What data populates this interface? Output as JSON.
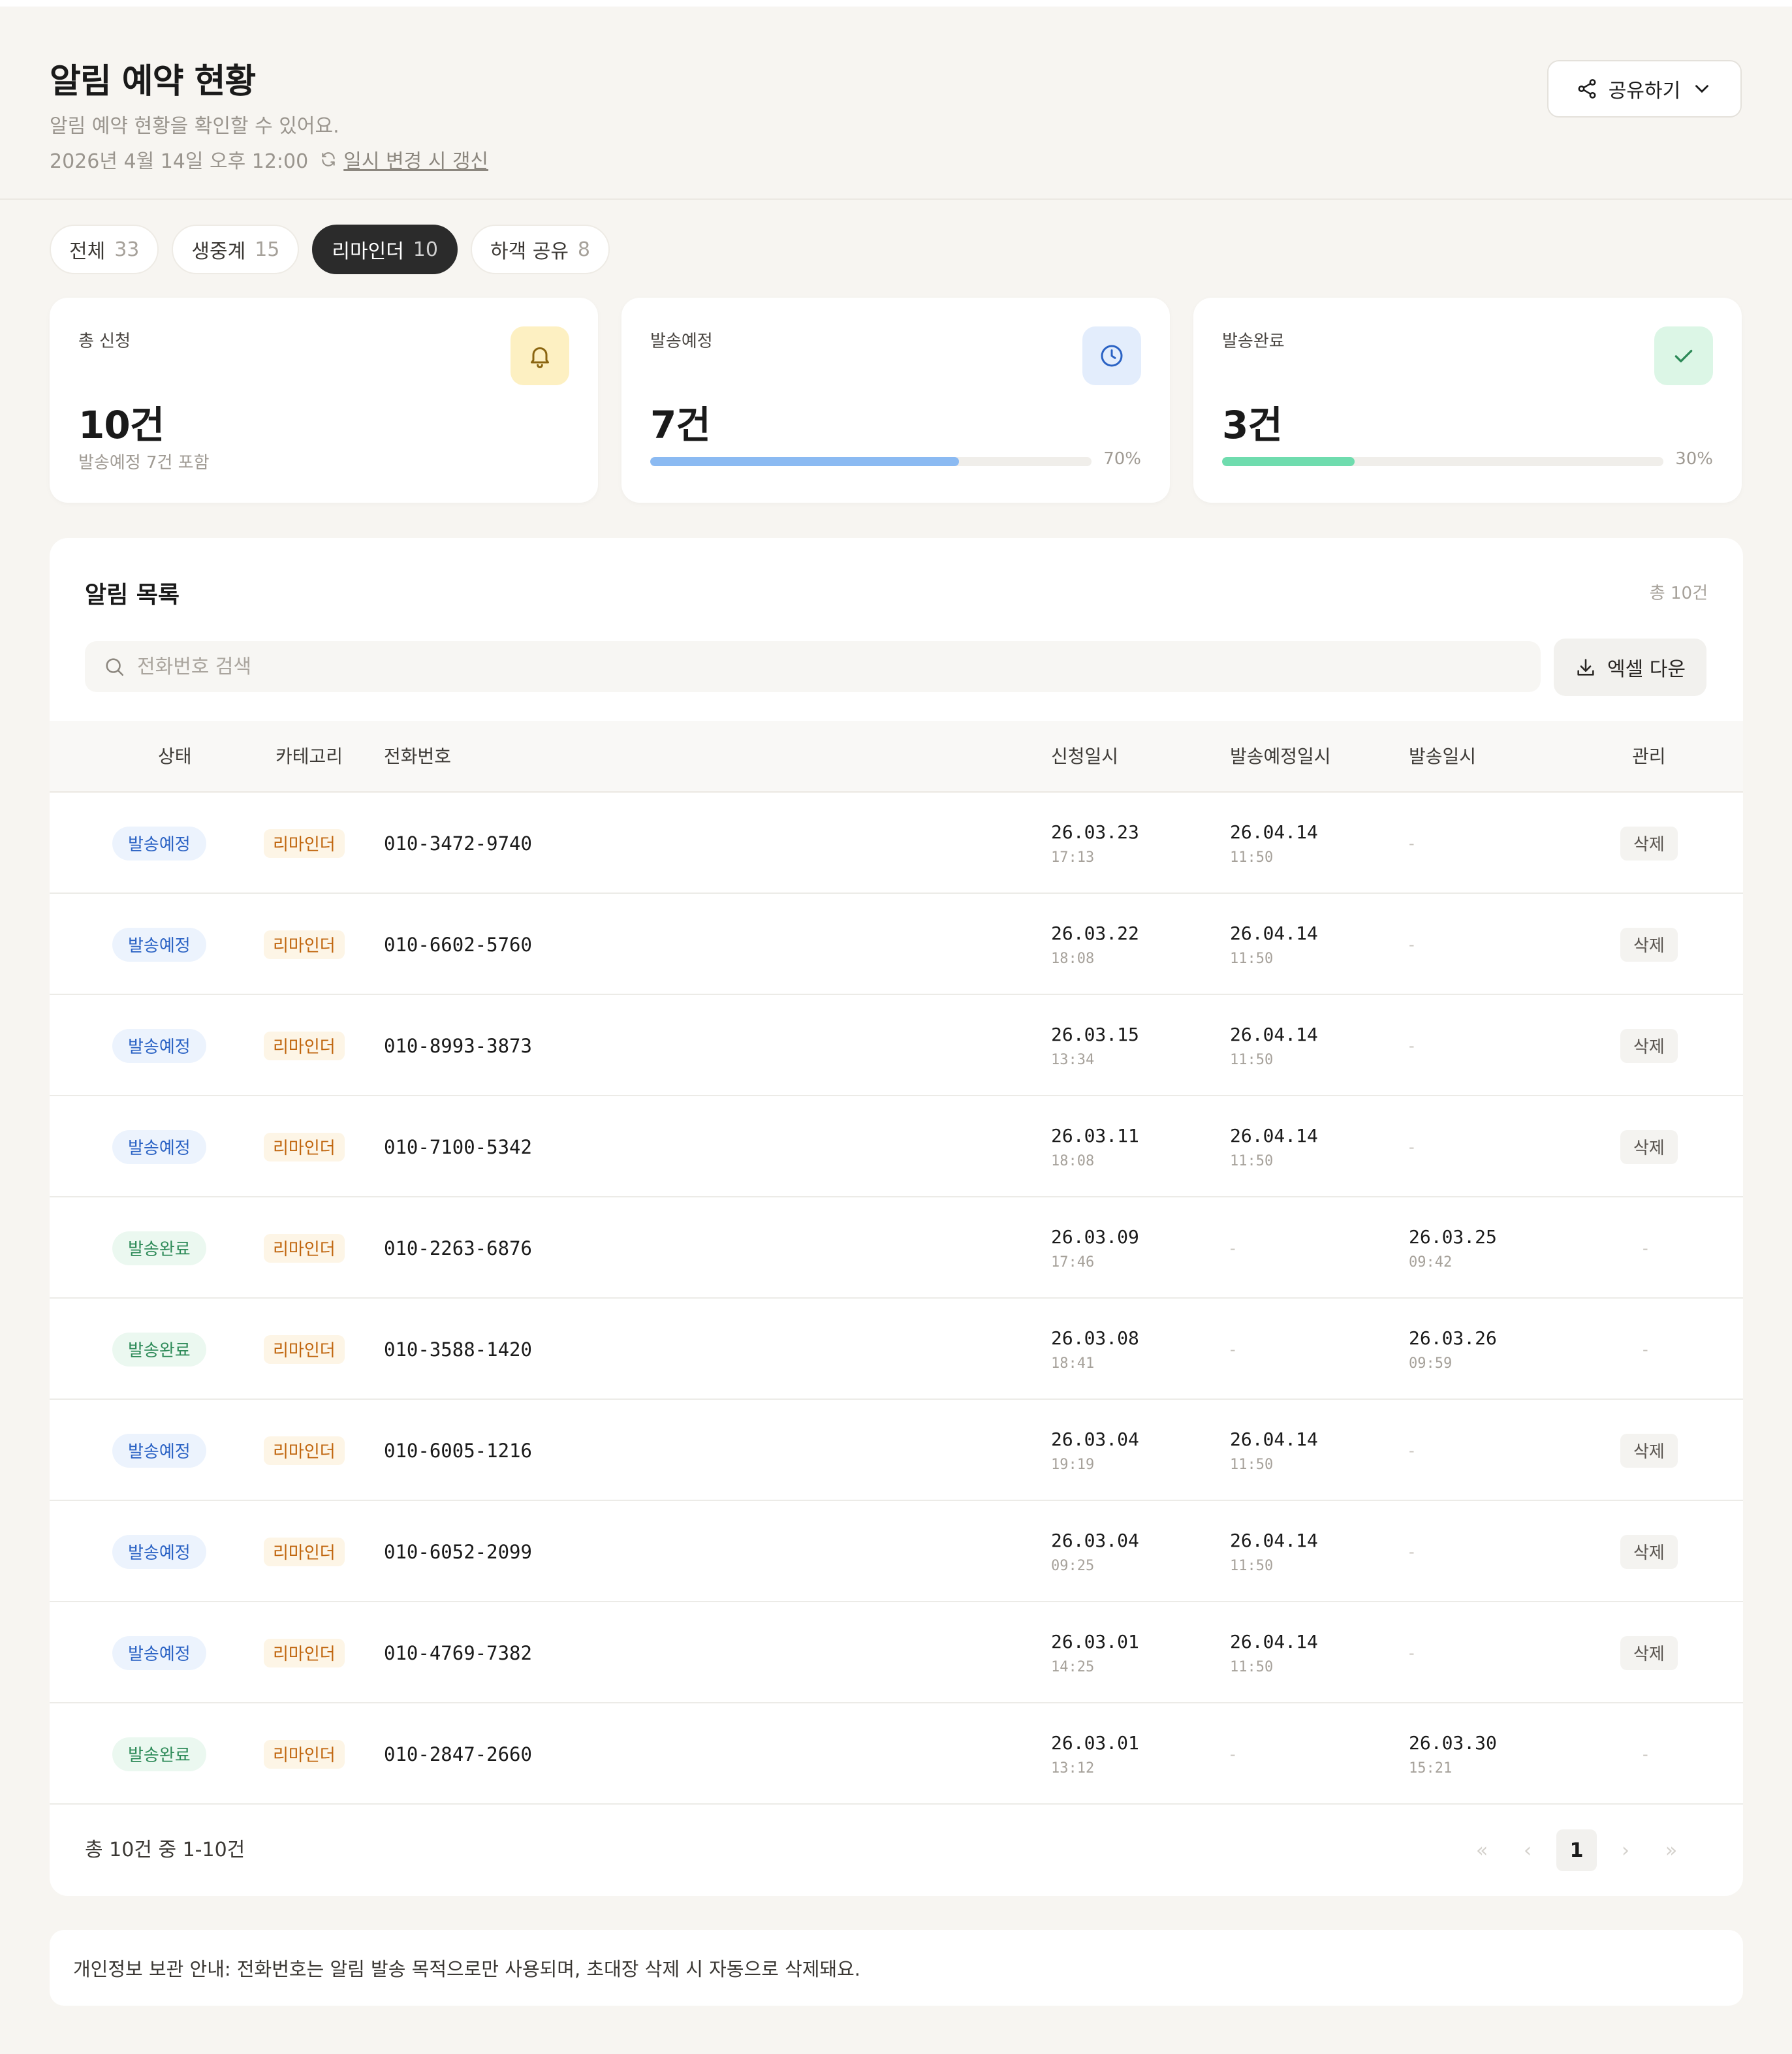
{
  "header": {
    "title": "알림 예약 현황",
    "subtitle": "알림 예약 현황을 확인할 수 있어요.",
    "timestamp": "2026년 4월 14일 오후 12:00",
    "refresh_label": "일시 변경 시 갱신",
    "share_label": "공유하기"
  },
  "tabs": [
    {
      "label": "전체",
      "count": "33"
    },
    {
      "label": "생중계",
      "count": "15"
    },
    {
      "label": "리마인더",
      "count": "10"
    },
    {
      "label": "하객 공유",
      "count": "8"
    }
  ],
  "cards": {
    "total": {
      "label": "총 신청",
      "value": "10건",
      "note": "발송예정 7건 포함",
      "icon": "bell-icon",
      "icon_bg": "#fdf0c2",
      "icon_color": "#8a6510"
    },
    "scheduled": {
      "label": "발송예정",
      "value": "7건",
      "percent_label": "70%",
      "percent": 0.7,
      "icon": "clock-icon",
      "icon_bg": "#e3edfc",
      "icon_color": "#2a62c4",
      "bar_color": "#8bbaf2"
    },
    "completed": {
      "label": "발송완료",
      "value": "3건",
      "percent_label": "30%",
      "percent": 0.3,
      "icon": "check-icon",
      "icon_bg": "#dcf6e6",
      "icon_color": "#2d8a58",
      "bar_color": "#6fdcae"
    }
  },
  "list": {
    "title": "알림 목록",
    "total": "총 10건",
    "search_placeholder": "전화번호 검색",
    "excel_label": "엑셀 다운",
    "columns": {
      "status": "상태",
      "category": "카테고리",
      "phone": "전화번호",
      "requested": "신청일시",
      "scheduled": "발송예정일시",
      "sent": "발송일시",
      "manage": "관리"
    },
    "rows": [
      {
        "status": "발송예정",
        "status_type": "scheduled",
        "category": "리마인더",
        "phone": "010-3472-9740",
        "req_date": "26.03.23",
        "req_time": "17:13",
        "sch_date": "26.04.14",
        "sch_time": "11:50",
        "sent_date": "",
        "sent_time": "",
        "action": "삭제"
      },
      {
        "status": "발송예정",
        "status_type": "scheduled",
        "category": "리마인더",
        "phone": "010-6602-5760",
        "req_date": "26.03.22",
        "req_time": "18:08",
        "sch_date": "26.04.14",
        "sch_time": "11:50",
        "sent_date": "",
        "sent_time": "",
        "action": "삭제"
      },
      {
        "status": "발송예정",
        "status_type": "scheduled",
        "category": "리마인더",
        "phone": "010-8993-3873",
        "req_date": "26.03.15",
        "req_time": "13:34",
        "sch_date": "26.04.14",
        "sch_time": "11:50",
        "sent_date": "",
        "sent_time": "",
        "action": "삭제"
      },
      {
        "status": "발송예정",
        "status_type": "scheduled",
        "category": "리마인더",
        "phone": "010-7100-5342",
        "req_date": "26.03.11",
        "req_time": "18:08",
        "sch_date": "26.04.14",
        "sch_time": "11:50",
        "sent_date": "",
        "sent_time": "",
        "action": "삭제"
      },
      {
        "status": "발송완료",
        "status_type": "done",
        "category": "리마인더",
        "phone": "010-2263-6876",
        "req_date": "26.03.09",
        "req_time": "17:46",
        "sch_date": "",
        "sch_time": "",
        "sent_date": "26.03.25",
        "sent_time": "09:42",
        "action": ""
      },
      {
        "status": "발송완료",
        "status_type": "done",
        "category": "리마인더",
        "phone": "010-3588-1420",
        "req_date": "26.03.08",
        "req_time": "18:41",
        "sch_date": "",
        "sch_time": "",
        "sent_date": "26.03.26",
        "sent_time": "09:59",
        "action": ""
      },
      {
        "status": "발송예정",
        "status_type": "scheduled",
        "category": "리마인더",
        "phone": "010-6005-1216",
        "req_date": "26.03.04",
        "req_time": "19:19",
        "sch_date": "26.04.14",
        "sch_time": "11:50",
        "sent_date": "",
        "sent_time": "",
        "action": "삭제"
      },
      {
        "status": "발송예정",
        "status_type": "scheduled",
        "category": "리마인더",
        "phone": "010-6052-2099",
        "req_date": "26.03.04",
        "req_time": "09:25",
        "sch_date": "26.04.14",
        "sch_time": "11:50",
        "sent_date": "",
        "sent_time": "",
        "action": "삭제"
      },
      {
        "status": "발송예정",
        "status_type": "scheduled",
        "category": "리마인더",
        "phone": "010-4769-7382",
        "req_date": "26.03.01",
        "req_time": "14:25",
        "sch_date": "26.04.14",
        "sch_time": "11:50",
        "sent_date": "",
        "sent_time": "",
        "action": "삭제"
      },
      {
        "status": "발송완료",
        "status_type": "done",
        "category": "리마인더",
        "phone": "010-2847-2660",
        "req_date": "26.03.01",
        "req_time": "13:12",
        "sch_date": "",
        "sch_time": "",
        "sent_date": "26.03.30",
        "sent_time": "15:21",
        "action": ""
      }
    ],
    "empty_mark": "-",
    "footer_count": "총 10건 중 1-10건",
    "pager": {
      "first": "«",
      "prev": "‹",
      "current": "1",
      "next": "›",
      "last": "»"
    }
  },
  "notice": "개인정보 보관 안내: 전화번호는 알림 발송 목적으로만 사용되며, 초대장 삭제 시 자동으로 삭제돼요."
}
